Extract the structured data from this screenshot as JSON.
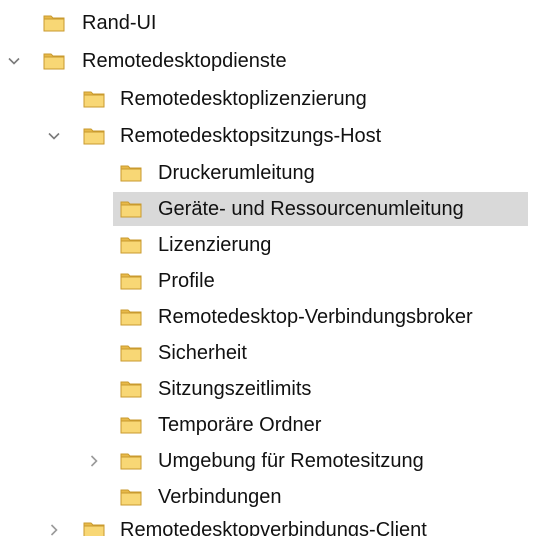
{
  "tree": {
    "items": [
      {
        "label": "Rand-UI",
        "expander": "none",
        "selected": false,
        "icon": "folder-icon"
      },
      {
        "label": "Remotedesktopdienste",
        "expander": "expanded",
        "selected": false,
        "icon": "folder-icon"
      },
      {
        "label": "Remotedesktoplizenzierung",
        "expander": "none",
        "selected": false,
        "icon": "folder-icon"
      },
      {
        "label": "Remotedesktopsitzungs-Host",
        "expander": "expanded",
        "selected": false,
        "icon": "folder-icon"
      },
      {
        "label": "Druckerumleitung",
        "expander": "none",
        "selected": false,
        "icon": "folder-icon"
      },
      {
        "label": "Geräte- und Ressourcenumleitung",
        "expander": "none",
        "selected": true,
        "icon": "folder-icon"
      },
      {
        "label": "Lizenzierung",
        "expander": "none",
        "selected": false,
        "icon": "folder-icon"
      },
      {
        "label": "Profile",
        "expander": "none",
        "selected": false,
        "icon": "folder-icon"
      },
      {
        "label": "Remotedesktop-Verbindungsbroker",
        "expander": "none",
        "selected": false,
        "icon": "folder-icon"
      },
      {
        "label": "Sicherheit",
        "expander": "none",
        "selected": false,
        "icon": "folder-icon"
      },
      {
        "label": "Sitzungszeitlimits",
        "expander": "none",
        "selected": false,
        "icon": "folder-icon"
      },
      {
        "label": "Temporäre Ordner",
        "expander": "none",
        "selected": false,
        "icon": "folder-icon"
      },
      {
        "label": "Umgebung für Remotesitzung",
        "expander": "collapsed",
        "selected": false,
        "icon": "folder-icon"
      },
      {
        "label": "Verbindungen",
        "expander": "none",
        "selected": false,
        "icon": "folder-icon"
      },
      {
        "label": "Remotedesktopverbindungs-Client",
        "expander": "collapsed",
        "selected": false,
        "icon": "folder-icon"
      }
    ]
  },
  "colors": {
    "selection": "#d9d9d9",
    "folder_fill": "#f8d775",
    "folder_back": "#e8b94a",
    "folder_edge": "#c99a2e",
    "chevron": "#7a7a7a",
    "text": "#111111"
  }
}
